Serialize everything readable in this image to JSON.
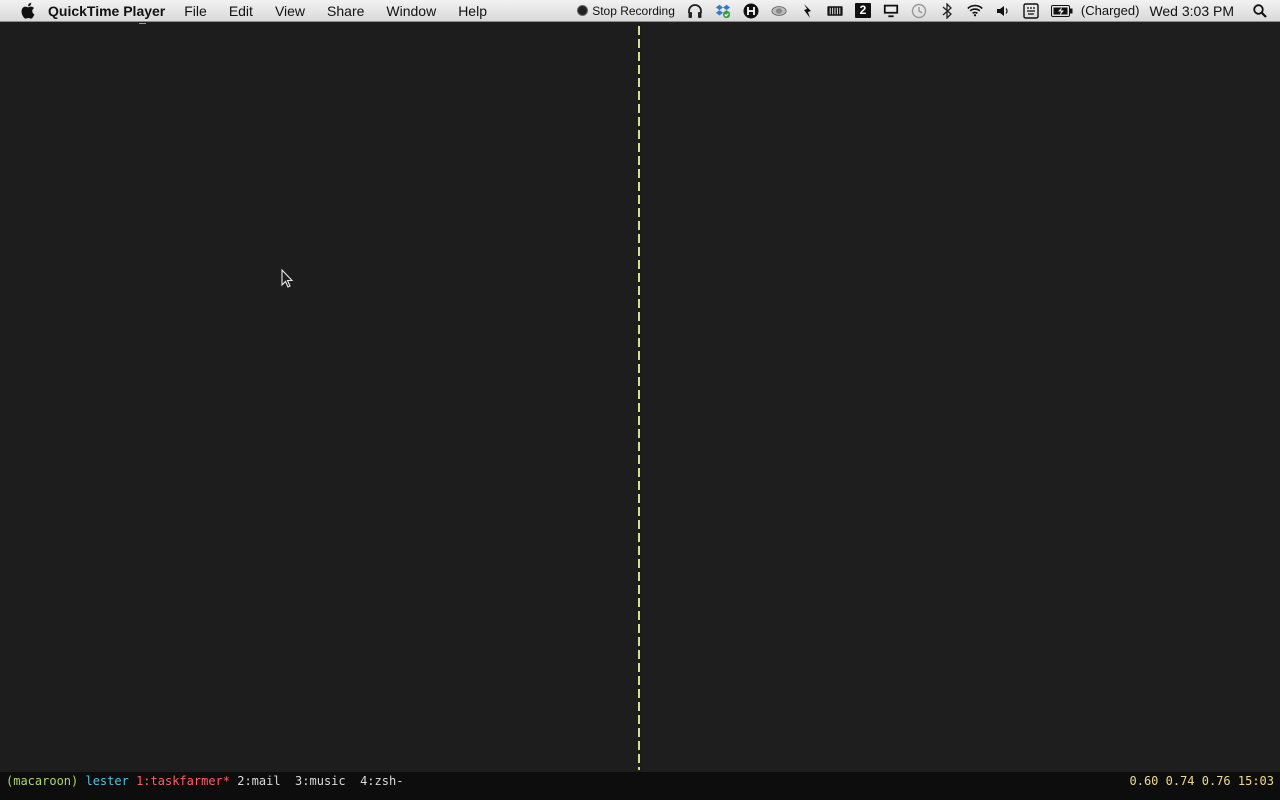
{
  "menubar": {
    "app_name": "QuickTime Player",
    "menus": [
      "File",
      "Edit",
      "View",
      "Share",
      "Window",
      "Help"
    ],
    "stop_recording": "Stop Recording",
    "battery_status": "(Charged)",
    "clock": "Wed 3:03 PM",
    "badge_two": "2"
  },
  "tmux": {
    "session": "(macaroon)",
    "host": "lester",
    "windows": [
      {
        "label": "1:taskfarmer*",
        "active": true
      },
      {
        "label": "2:mail",
        "active": false
      },
      {
        "label": "3:music",
        "active": false
      },
      {
        "label": "4:zsh-",
        "active": false
      }
    ],
    "load_and_time": "0.60 0.74 0.76 15:03"
  },
  "colors": {
    "background": "#1c1c1c",
    "divider": "#cfe28e",
    "session": "#a6d96a",
    "host": "#56c0e0",
    "active_window": "#ff5f5f",
    "status_right": "#f0d98a"
  },
  "icons": [
    "apple-icon",
    "record-icon",
    "headphones-icon",
    "dropbox-icon",
    "growl-icon",
    "eye-icon",
    "evernote-icon",
    "cpu-meter-icon",
    "tag-icon",
    "display-icon",
    "time-machine-icon",
    "bluetooth-icon",
    "wifi-icon",
    "volume-icon",
    "keyboard-icon",
    "battery-icon",
    "spotlight-icon"
  ]
}
